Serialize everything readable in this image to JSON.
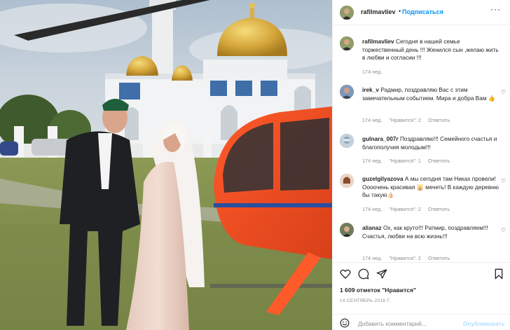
{
  "post": {
    "username": "rafilmavliev",
    "dot": "•",
    "follow_label": "Подписаться",
    "more_label": "···",
    "caption_user": "rafilmavliev",
    "caption_text": "Сегодня в нашей семье торжественный день !!! Женился сын ,желаю жить в любви и согласии !!!",
    "caption_time": "174 нед."
  },
  "comments": [
    {
      "user": "irek_v",
      "text": "Радмир, поздравляю Вас с этим замечательным событием. Мира и добра Вам 👍",
      "time": "174 нед.",
      "likes": "\"Нравится\": 2",
      "reply": "Ответить"
    },
    {
      "user": "gulnara_007r",
      "text": "Поздравляю!!! Семейного счастья и благополучия молодым!!!",
      "time": "174 нед.",
      "likes": "\"Нравится\": 1",
      "reply": "Ответить"
    },
    {
      "user": "guzelgilyazova",
      "text": "А мы сегодня там Никах провели! Оооочень красивая 🕌 мечеть! В каждую деревню бы такую👍🏻",
      "time": "174 нед.",
      "likes": "\"Нравится\": 2",
      "reply": "Ответить"
    },
    {
      "user": "alianaz",
      "text": "Ох, как круто!!! Ратмир, поздравляем!!! Счастья, любви на всю жизнь!!!",
      "time": "174 нед.",
      "likes": "\"Нравится\": 2",
      "reply": "Ответить"
    }
  ],
  "actions": {
    "likes_text": "1 609 отметок \"Нравится\"",
    "date_text": "14 СЕНТЯБРЬ 2018 Г.",
    "add_comment_placeholder": "Добавить комментарий...",
    "publish_label": "Опубликовать"
  },
  "colors": {
    "accent": "#0095f6",
    "publish_disabled": "#b2dffc",
    "muted": "#8e8e8e",
    "text": "#262626"
  },
  "icons": [
    "heart-icon",
    "comment-icon",
    "share-icon",
    "bookmark-icon",
    "emoji-icon",
    "more-icon"
  ]
}
